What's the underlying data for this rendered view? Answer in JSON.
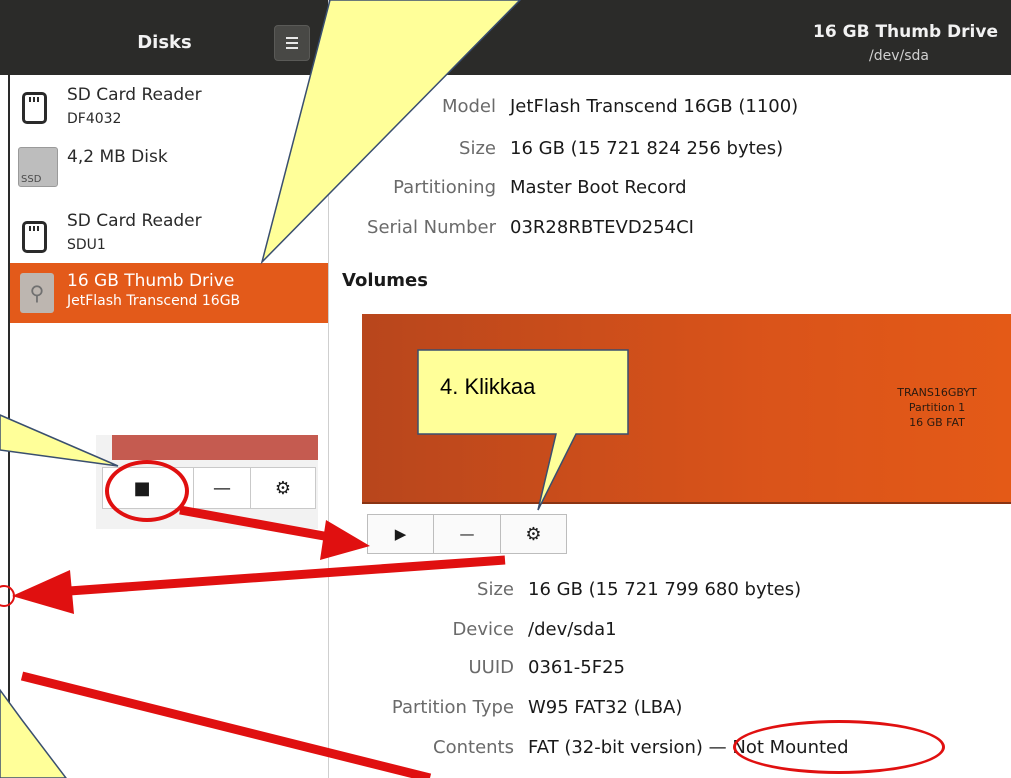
{
  "header": {
    "app_title": "Disks",
    "drive_title": "16 GB Thumb Drive",
    "drive_path": "/dev/sda"
  },
  "sidebar": {
    "items": [
      {
        "name": "SD Card Reader",
        "sub": "DF4032",
        "icon": "sd-card-icon"
      },
      {
        "name": "4,2 MB Disk",
        "sub": "",
        "icon": "ssd-icon",
        "icon_text": "SSD"
      },
      {
        "name": "SD Card Reader",
        "sub": "SDU1",
        "icon": "sd-card-icon"
      },
      {
        "name": "16 GB Thumb Drive",
        "sub": "JetFlash Transcend 16GB",
        "icon": "usb-icon",
        "selected": true
      }
    ]
  },
  "drive_props": [
    {
      "label": "Model",
      "value": "JetFlash Transcend 16GB (1100)"
    },
    {
      "label": "Size",
      "value": "16 GB (15 721 824 256 bytes)"
    },
    {
      "label": "Partitioning",
      "value": "Master Boot Record"
    },
    {
      "label": "Serial Number",
      "value": "03R28RBTEVD254CI"
    }
  ],
  "volumes": {
    "heading": "Volumes",
    "partition": {
      "line1": "TRANS16GBYT",
      "line2": "Partition 1",
      "line3": "16 GB FAT"
    },
    "colors": {
      "partition": "#e35a1a",
      "selected_row": "#e35a1a"
    }
  },
  "volume_props": [
    {
      "label": "Size",
      "value": "16 GB (15 721 799 680 bytes)"
    },
    {
      "label": "Device",
      "value": "/dev/sda1"
    },
    {
      "label": "UUID",
      "value": "0361-5F25"
    },
    {
      "label": "Partition Type",
      "value": "W95 FAT32 (LBA)"
    },
    {
      "label": "Contents",
      "value": "FAT (32-bit version)",
      "extra": " — Not Mounted"
    }
  ],
  "toolbar": {
    "play_symbol": "▶",
    "minus_symbol": "—",
    "gear_symbol": "⚙",
    "stop_symbol": "■"
  },
  "annotations": {
    "callout_4": "4. Klikkaa"
  }
}
